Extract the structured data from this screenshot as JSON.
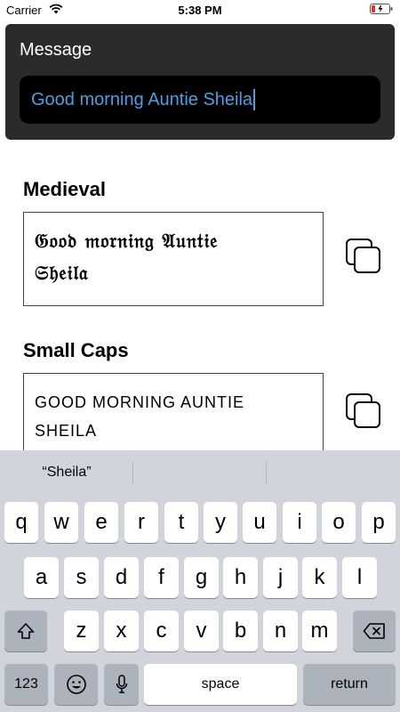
{
  "status_bar": {
    "carrier": "Carrier",
    "time": "5:38 PM",
    "battery_color": "#e5322d"
  },
  "message": {
    "label": "Message",
    "value": "Good morning Auntie Sheila",
    "text_color": "#4f9ee0"
  },
  "sections": [
    {
      "title": "Medieval",
      "lines": [
        "𝔊𝔬𝔬𝔡 𝔪𝔬𝔯𝔫𝔦𝔫𝔤 𝔄𝔲𝔫𝔱𝔦𝔢",
        "𝔖𝔥𝔢𝔦𝔩𝔞"
      ],
      "copy_icon": "copy-icon"
    },
    {
      "title": "Small Caps",
      "lines": [
        "GOOD MORNING AUNTIE",
        "SHEILA"
      ],
      "copy_icon": "copy-icon"
    }
  ],
  "keyboard": {
    "predictions": [
      "“Sheila”",
      "",
      ""
    ],
    "row1": [
      "q",
      "w",
      "e",
      "r",
      "t",
      "y",
      "u",
      "i",
      "o",
      "p"
    ],
    "row2": [
      "a",
      "s",
      "d",
      "f",
      "g",
      "h",
      "j",
      "k",
      "l"
    ],
    "row3": [
      "z",
      "x",
      "c",
      "v",
      "b",
      "n",
      "m"
    ],
    "numbers_label": "123",
    "space_label": "space",
    "return_label": "return",
    "shift_icon": "shift-icon",
    "delete_icon": "delete-icon",
    "emoji_icon": "emoji-icon",
    "mic_icon": "microphone-icon"
  }
}
